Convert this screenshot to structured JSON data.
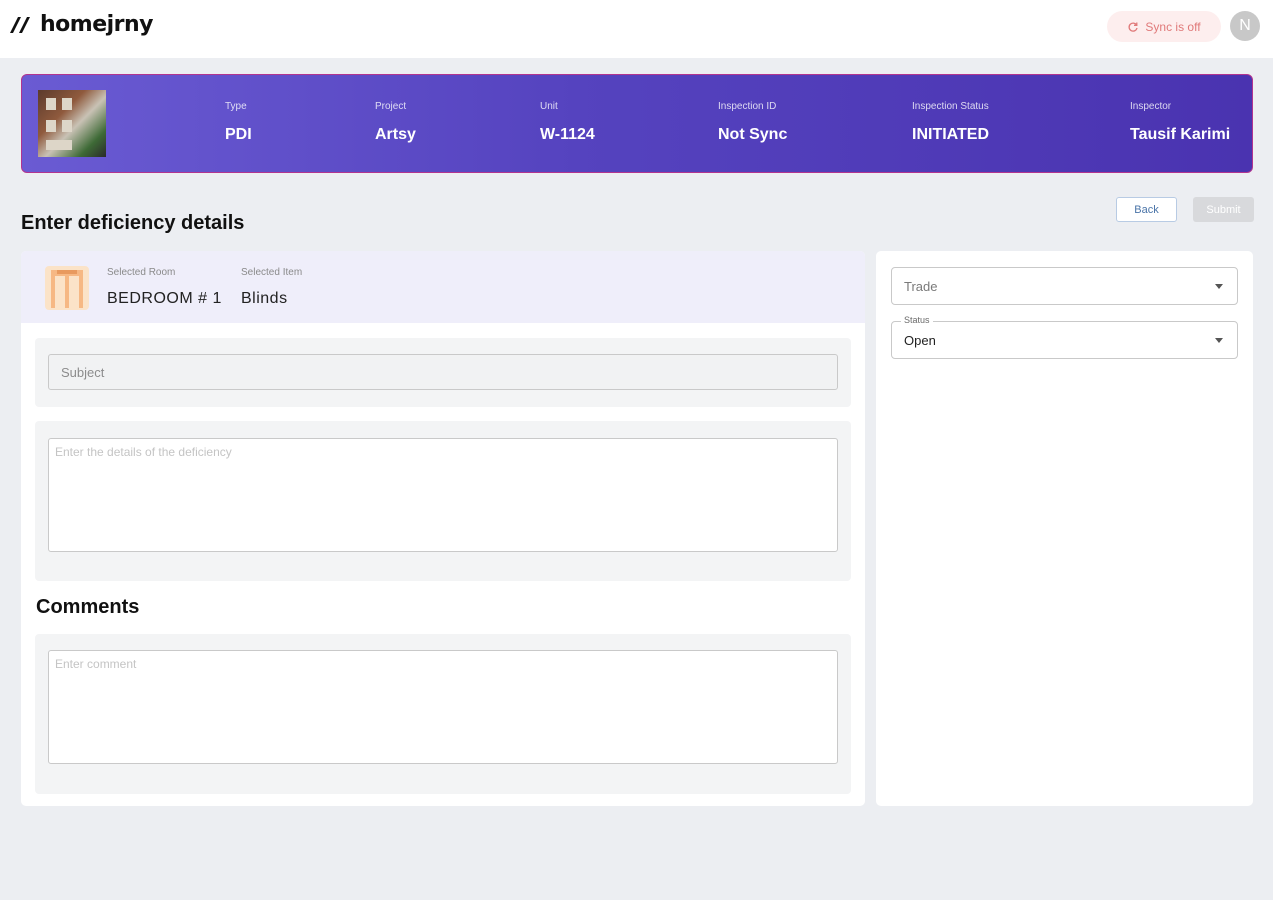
{
  "app": {
    "brand": "homejrny",
    "sync_label": "Sync is off",
    "avatar_initial": "N"
  },
  "banner": {
    "fields": [
      {
        "label": "Type",
        "value": "PDI"
      },
      {
        "label": "Project",
        "value": "Artsy"
      },
      {
        "label": "Unit",
        "value": "W-1124"
      },
      {
        "label": "Inspection ID",
        "value": "Not Sync"
      },
      {
        "label": "Inspection Status",
        "value": "INITIATED"
      },
      {
        "label": "Inspector",
        "value": "Tausif Karimi"
      }
    ]
  },
  "page": {
    "title": "Enter deficiency details",
    "back_label": "Back",
    "submit_label": "Submit"
  },
  "selection": {
    "room_label": "Selected Room",
    "room_value": "BEDROOM # 1",
    "item_label": "Selected Item",
    "item_value": "Blinds"
  },
  "form": {
    "subject_placeholder": "Subject",
    "details_placeholder": "Enter the details of the deficiency",
    "comments_title": "Comments",
    "comment_placeholder": "Enter comment"
  },
  "sidebar": {
    "trade_placeholder": "Trade",
    "status_label": "Status",
    "status_value": "Open"
  },
  "colors": {
    "banner_start": "#6a5bd3",
    "banner_end": "#4a33b0",
    "sync_off": "#e07a7a"
  }
}
